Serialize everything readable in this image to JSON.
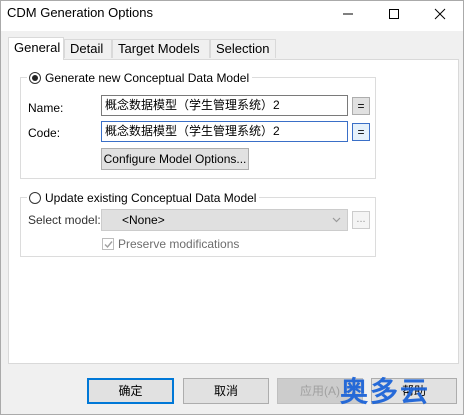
{
  "window": {
    "title": "CDM Generation Options"
  },
  "tabs": [
    "General",
    "Detail",
    "Target Models",
    "Selection"
  ],
  "group_new": {
    "radio_label": "Generate new Conceptual Data Model",
    "name_label": "Name:",
    "name_value": "概念数据模型（学生管理系统）2",
    "code_label": "Code:",
    "code_value": "概念数据模型（学生管理系统）2",
    "eq_button": "=",
    "configure_button": "Configure Model Options..."
  },
  "group_update": {
    "radio_label": "Update existing Conceptual Data Model",
    "select_label": "Select model:",
    "select_value": "<None>",
    "dots_button": "...",
    "preserve_label": "Preserve modifications"
  },
  "footer": {
    "ok": "确定",
    "cancel": "取消",
    "apply": "应用(A)",
    "help": "帮助"
  },
  "watermark": "奥多云",
  "colors": {
    "accent": "#0078d7",
    "watermark": "#1d64d8"
  }
}
